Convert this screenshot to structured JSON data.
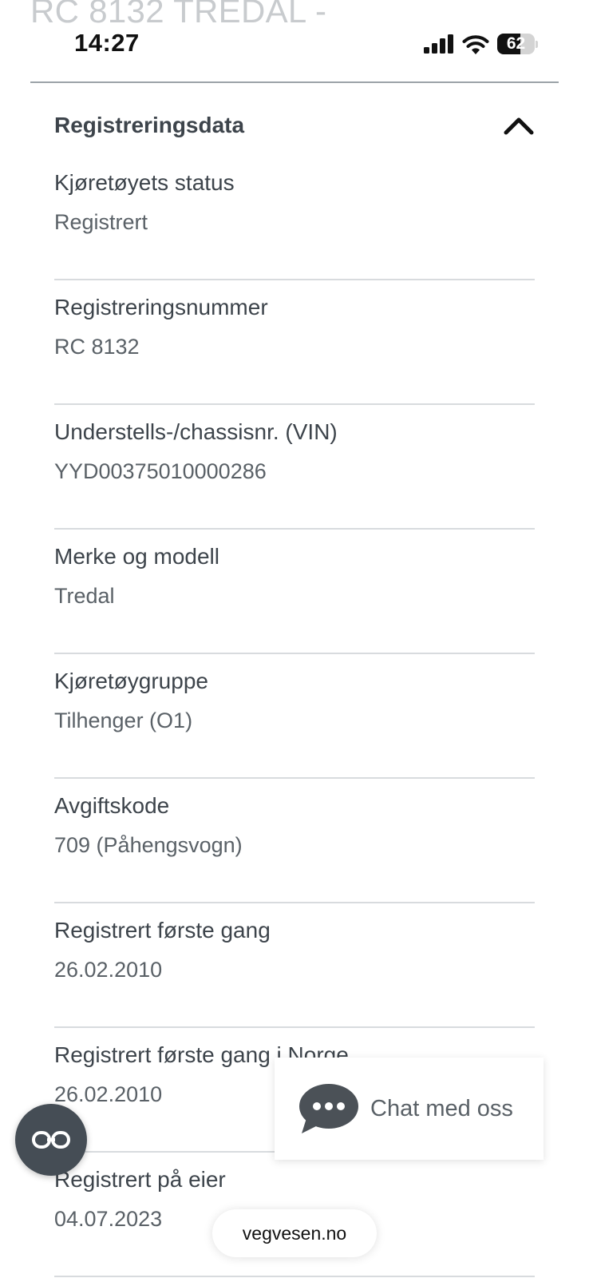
{
  "header": {
    "ghost_title": "RC 8132 TREDAL -",
    "time": "14:27",
    "battery_level": "62",
    "battery_fraction": 0.62,
    "icons": [
      "signal-icon",
      "wifi-icon",
      "battery-icon"
    ]
  },
  "section": {
    "title": "Registreringsdata",
    "toggle_icon": "chevron-up-icon"
  },
  "fields": [
    {
      "label": "Kjøretøyets status",
      "value": "Registrert"
    },
    {
      "label": "Registreringsnummer",
      "value": "RC 8132"
    },
    {
      "label": "Understells-/chassisnr. (VIN)",
      "value": "YYD00375010000286"
    },
    {
      "label": "Merke og modell",
      "value": "Tredal"
    },
    {
      "label": "Kjøretøygruppe",
      "value": "Tilhenger (O1)"
    },
    {
      "label": "Avgiftskode",
      "value": "709 (Påhengsvogn)"
    },
    {
      "label": "Registrert første gang",
      "value": "26.02.2010"
    },
    {
      "label": "Registrert første gang i Norge",
      "value": "26.02.2010"
    },
    {
      "label": "Registrert på eier",
      "value": "04.07.2023"
    }
  ],
  "chat": {
    "label": "Chat med oss",
    "icon": "chat-bubble-icon"
  },
  "fab": {
    "icon": "glasses-icon"
  },
  "browser": {
    "url": "vegvesen.no"
  },
  "colors": {
    "text": "#3d444b",
    "value_text": "#5a6167",
    "divider": "#d8dbde",
    "fab": "#454d55"
  }
}
